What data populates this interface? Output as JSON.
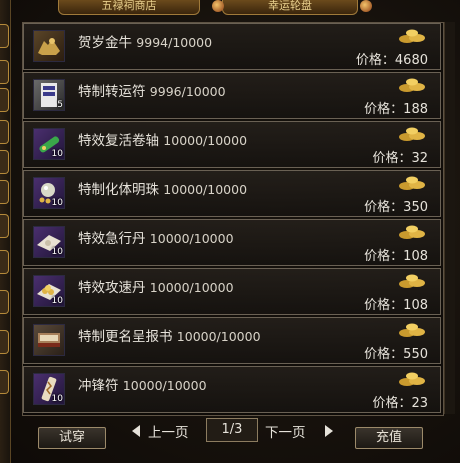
{
  "top_tabs": {
    "left": "五禄祠商店",
    "right": "幸运轮盘"
  },
  "currency_icon": "gold-ingot-icon",
  "price_prefix": "价格：",
  "items": [
    {
      "name": "贺岁金牛",
      "count": "9994/10000",
      "price": "4680",
      "qty": "",
      "icon": "golden-ox-icon"
    },
    {
      "name": "特制转运符",
      "count": "9996/10000",
      "price": "188",
      "qty": "5",
      "icon": "luck-talisman-icon"
    },
    {
      "name": "特效复活卷轴",
      "count": "10000/10000",
      "price": "32",
      "qty": "10",
      "icon": "revive-scroll-icon"
    },
    {
      "name": "特制化体明珠",
      "count": "10000/10000",
      "price": "350",
      "qty": "10",
      "icon": "pearl-icon"
    },
    {
      "name": "特效急行丹",
      "count": "10000/10000",
      "price": "108",
      "qty": "10",
      "icon": "speed-pill-icon"
    },
    {
      "name": "特效攻速丹",
      "count": "10000/10000",
      "price": "108",
      "qty": "10",
      "icon": "attack-speed-pill-icon"
    },
    {
      "name": "特制更名呈报书",
      "count": "10000/10000",
      "price": "550",
      "qty": "",
      "icon": "rename-book-icon"
    },
    {
      "name": "冲锋符",
      "count": "10000/10000",
      "price": "23",
      "qty": "10",
      "icon": "charge-talisman-icon"
    }
  ],
  "buttons": {
    "try_on": "试穿",
    "recharge": "充值"
  },
  "pager": {
    "prev": "上一页",
    "next": "下一页",
    "page": "1/3"
  }
}
